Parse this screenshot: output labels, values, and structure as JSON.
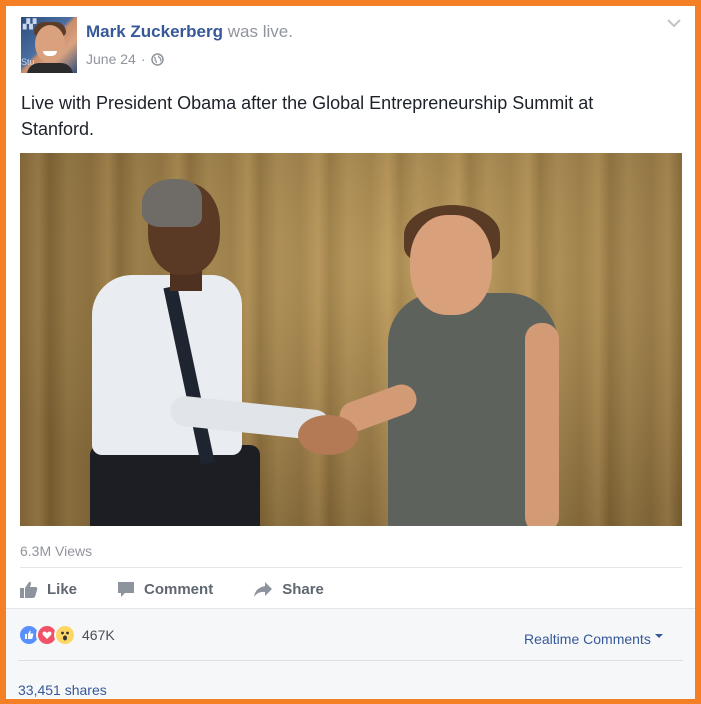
{
  "post": {
    "author": "Mark Zuckerberg",
    "action": "was live.",
    "date": "June 24",
    "separator": "·",
    "privacy_icon": "globe-icon",
    "text": "Live with President Obama after the Global Entrepreneurship Summit at Stanford.",
    "avatar_text_top": "Stu"
  },
  "video": {
    "views": "6.3M Views"
  },
  "actions": {
    "like": "Like",
    "comment": "Comment",
    "share": "Share"
  },
  "feedback": {
    "reaction_count": "467K",
    "reactions": [
      "like-icon",
      "love-icon",
      "wow-icon"
    ],
    "realtime_comments": "Realtime Comments",
    "shares": "33,451 shares"
  },
  "colors": {
    "frame_border": "#f47f24",
    "link": "#365899",
    "muted": "#90949c"
  }
}
